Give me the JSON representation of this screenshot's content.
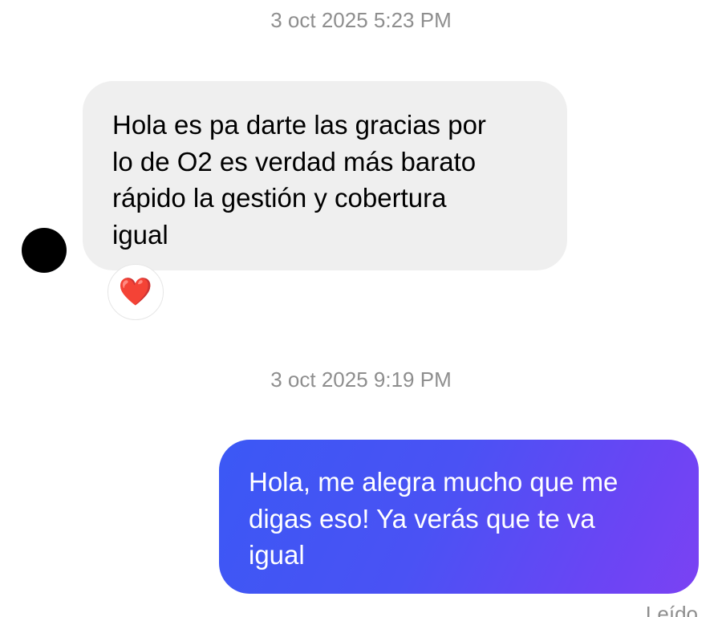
{
  "timestamps": [
    "3 oct 2025 5:23 PM",
    "3 oct 2025 9:19 PM"
  ],
  "incoming_message": {
    "text": "Hola es pa darte las gracias por\nlo de O2 es verdad más barato\nrápido la gestión  y cobertura\nigual",
    "reaction": "❤️",
    "bubble_color": "#efefef"
  },
  "outgoing_message": {
    "text": "Hola, me alegra mucho que me\ndigas eso! Ya verás que te va\nigual",
    "gradient_start": "#3b58f5",
    "gradient_end": "#7b42f3"
  },
  "read_status": "Leído",
  "avatar": {
    "icon": "profile-avatar"
  }
}
